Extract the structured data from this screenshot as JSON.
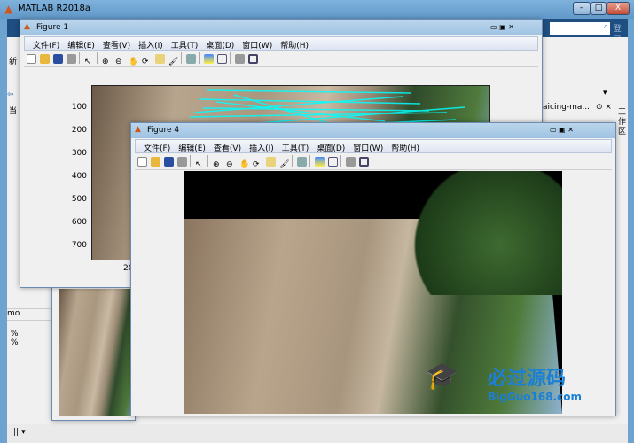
{
  "main": {
    "title": "MATLAB R2018a",
    "login": "登录",
    "tab_partial": "aicing-ma...",
    "workspace_vertical": "工作区",
    "left_partial": "mo",
    "comment1": "%",
    "comment2": "%",
    "ribbon_left_partial": "新",
    "current_partial": "当"
  },
  "menu": [
    "文件(F)",
    "编辑(E)",
    "查看(V)",
    "插入(I)",
    "工具(T)",
    "桌面(D)",
    "窗口(W)",
    "帮助(H)"
  ],
  "figure1": {
    "title": "Figure 1",
    "yticks": [
      "100",
      "200",
      "300",
      "400",
      "500",
      "600",
      "700"
    ],
    "xtick_partial": "20"
  },
  "figure4": {
    "title": "Figure 4"
  },
  "watermark": {
    "text": "必过源码",
    "url": "BigGuo168.com"
  },
  "colors": {
    "match_lines": "#00ffff",
    "titlebar": "#6fa3cf"
  }
}
